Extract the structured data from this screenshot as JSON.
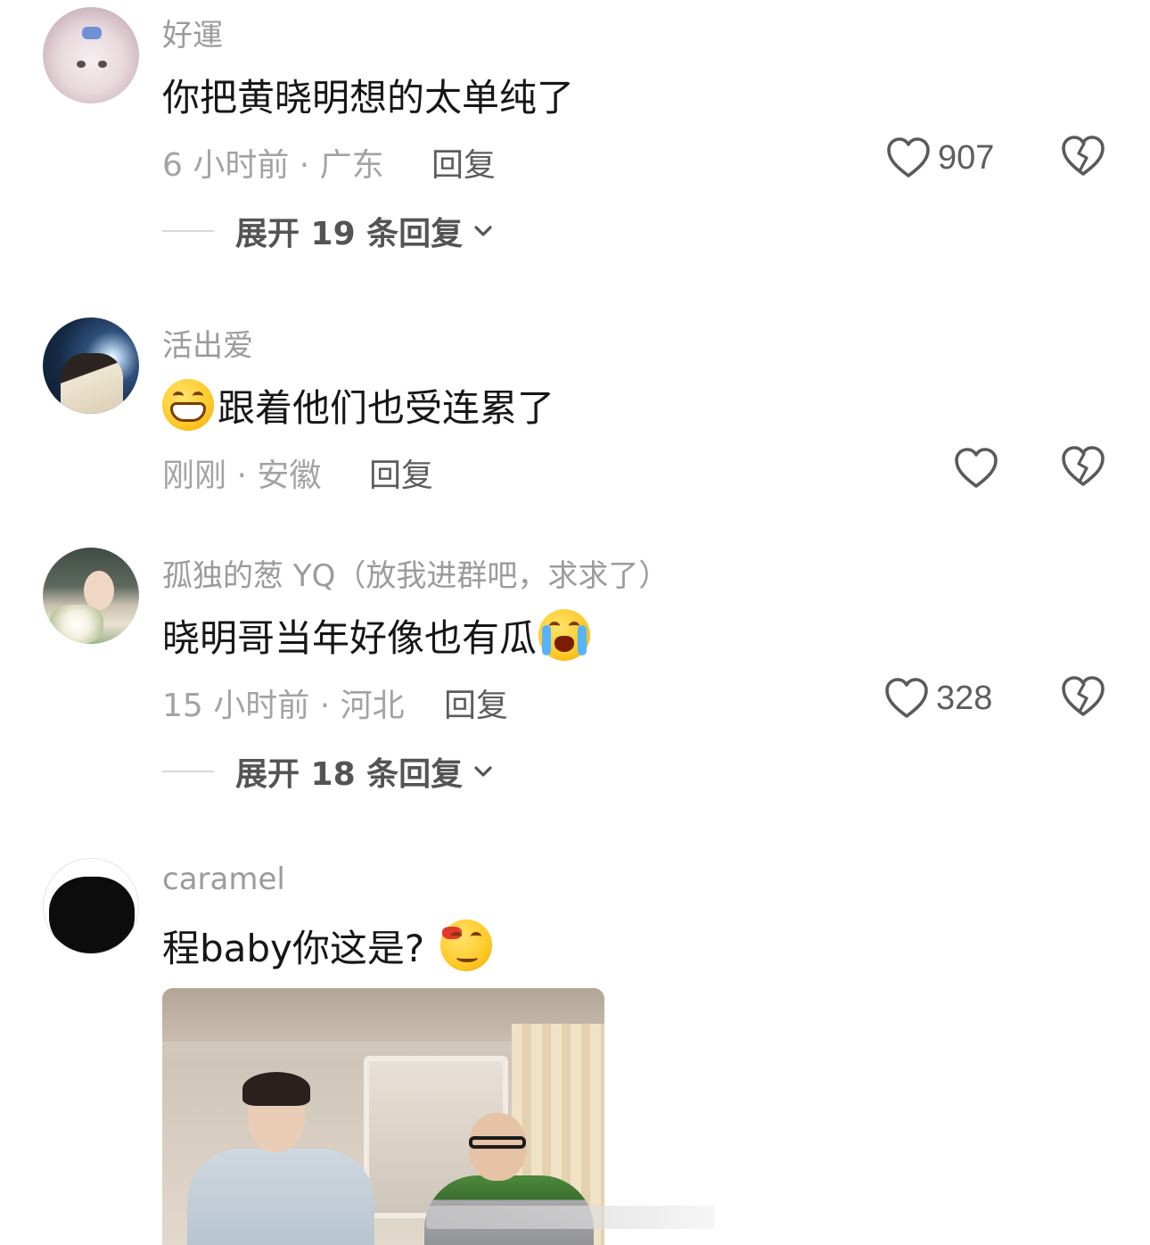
{
  "comments": [
    {
      "username": "好運",
      "text": "你把黄晓明想的太单纯了",
      "meta": "6 小时前 · 广东",
      "reply_label": "回复",
      "likes": "907",
      "expand_label": "展开 19 条回复"
    },
    {
      "username": "活出爱",
      "text": "跟着他们也受连累了",
      "emoji_before": "grinning-face-emoji",
      "meta": "刚刚 · 安徽",
      "reply_label": "回复",
      "likes": ""
    },
    {
      "username": "孤独的葱 YQ（放我进群吧，求求了）",
      "text": "晓明哥当年好像也有瓜",
      "emoji_after": "crying-face-emoji",
      "meta": "15 小时前 · 河北",
      "reply_label": "回复",
      "likes": "328",
      "expand_label": "展开 18 条回复"
    },
    {
      "username": "caramel",
      "text": "程baby你这是?",
      "emoji_after": "smug-face-emoji",
      "attachment": "photo"
    }
  ],
  "icons": {
    "like": "heart-outline-icon",
    "dislike": "broken-heart-icon",
    "expand": "chevron-down-icon"
  }
}
